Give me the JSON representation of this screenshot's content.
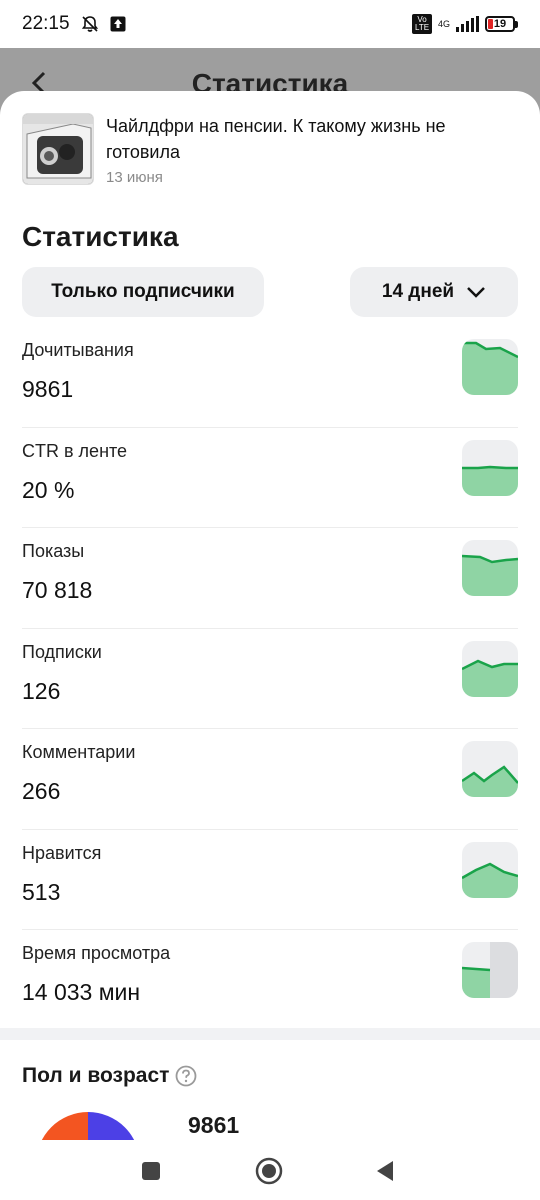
{
  "status_bar": {
    "time": "22:15",
    "volte": "Vo LTE",
    "network": "4G",
    "battery": "19"
  },
  "header": {
    "title": "Статистика"
  },
  "article": {
    "title": "Чайлдфри на пенсии. К такому жизнь не готовила",
    "date": "13 июня"
  },
  "stats": {
    "title": "Статистика",
    "filter_audience": "Только подписчики",
    "filter_period": "14 дней",
    "metrics": [
      {
        "label": "Дочитывания",
        "value": "9861"
      },
      {
        "label": "CTR в ленте",
        "value": "20 %"
      },
      {
        "label": "Показы",
        "value": "70 818"
      },
      {
        "label": "Подписки",
        "value": "126"
      },
      {
        "label": "Комментарии",
        "value": "266"
      },
      {
        "label": "Нравится",
        "value": "513"
      },
      {
        "label": "Время просмотра",
        "value": "14 033 мин"
      }
    ]
  },
  "demographics": {
    "title": "Пол и возраст",
    "total": "9861"
  },
  "colors": {
    "spark_line": "#1aa34a",
    "spark_fill": "#8fd4a4",
    "spark_bg": "#eeeff1",
    "pie_orange": "#f35521",
    "pie_blue": "#4c40e6",
    "battery_low": "#e02424"
  },
  "icons": {
    "back": "arrow-left-icon",
    "mute": "bell-off-icon",
    "upload": "upload-icon",
    "chevron": "chevron-down-icon",
    "help": "question-circle-icon",
    "nav_recent": "square-icon",
    "nav_home": "circle-icon",
    "nav_back": "triangle-left-icon"
  }
}
